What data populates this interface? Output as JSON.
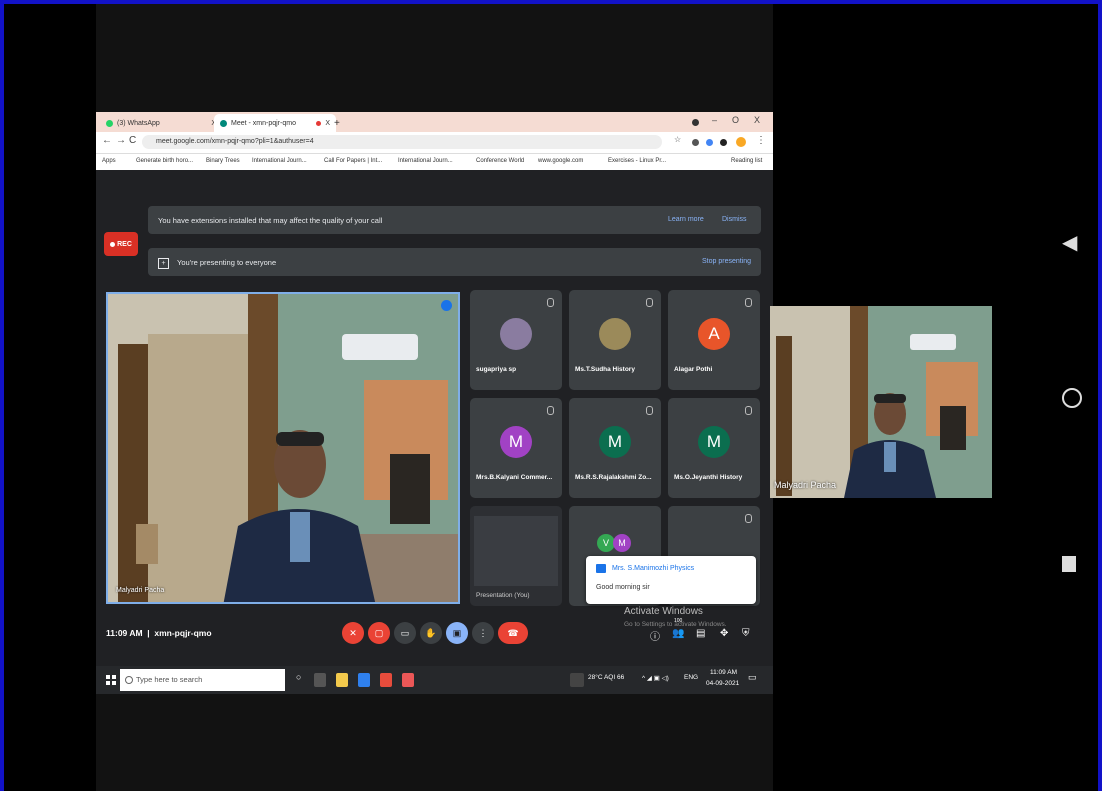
{
  "browser": {
    "tabs": [
      {
        "label": "(3) WhatsApp",
        "close": "X"
      },
      {
        "label": "Meet - xmn-pqjr-qmo",
        "close": "X"
      }
    ],
    "new_tab": "+",
    "window_controls": {
      "minimize": "–",
      "maximize": "O",
      "close": "X"
    },
    "url": "meet.google.com/xmn-pqjr-qmo?pli=1&authuser=4",
    "apps_label": "Apps",
    "bookmarks": [
      "Generate birth horo...",
      "Binary Trees",
      "International Journ...",
      "Call For Papers | Int...",
      "International Journ...",
      "Conference World",
      "www.google.com",
      "Exercises - Linux Pr..."
    ],
    "reading_list": "Reading list"
  },
  "meet": {
    "rec_label": "REC",
    "extension_banner": {
      "text": "You have extensions installed that may affect the quality of your call",
      "learn_more": "Learn more",
      "dismiss": "Dismiss"
    },
    "presenting_banner": {
      "text": "You're presenting to everyone",
      "stop": "Stop presenting"
    },
    "main_speaker": "Malyadri Pacha",
    "participants": [
      {
        "name": "sugapriya sp",
        "avatar": "",
        "color": "#8a7ca0"
      },
      {
        "name": "Ms.T.Sudha History",
        "avatar": "",
        "color": "#9b8a5a"
      },
      {
        "name": "Alagar Pothi",
        "avatar": "A",
        "color": "#e8552a"
      },
      {
        "name": "Mrs.B.Kalyani Commer...",
        "avatar": "M",
        "color": "#a142c4"
      },
      {
        "name": "Ms.R.S.Rajalakshmi Zo...",
        "avatar": "M",
        "color": "#0b6e4f"
      },
      {
        "name": "Ms.O.Jeyanthi History",
        "avatar": "M",
        "color": "#0b6e4f"
      }
    ],
    "presentation_tile_label": "Presentation (You)",
    "group_avatars": [
      "V",
      "M"
    ],
    "chat_toast": {
      "sender": "Mrs. S.Manimozhi Physics",
      "message": "Good morning sir"
    },
    "time": "11:09 AM",
    "meeting_code": "xmn-pqjr-qmo",
    "activate_windows": {
      "title": "Activate Windows",
      "subtitle": "Go to Settings to activate Windows."
    },
    "people_count": "100"
  },
  "taskbar": {
    "search_placeholder": "Type here to search",
    "weather": "28°C  AQI 66",
    "language": "ENG",
    "clock_time": "11:09 AM",
    "clock_date": "04-09-2021"
  },
  "pip_name": "Malyadri Pacha",
  "colors": {
    "border_blue": "#1212c8",
    "meet_bg": "#202124",
    "end_call_red": "#d93025",
    "mic_off_red": "#ea4335",
    "accent_blue": "#8ab4f8"
  }
}
